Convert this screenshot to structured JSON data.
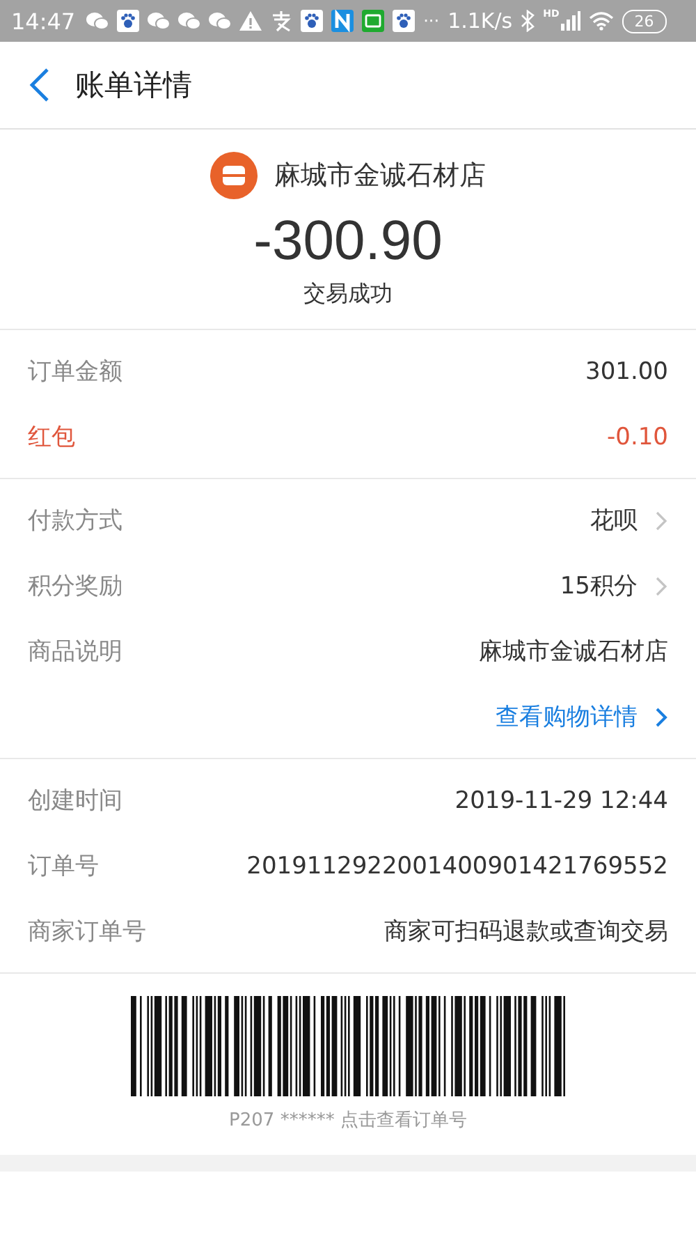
{
  "status_bar": {
    "time": "14:47",
    "icons": [
      {
        "kind": "chat"
      },
      {
        "kind": "paw"
      },
      {
        "kind": "chat"
      },
      {
        "kind": "chat"
      },
      {
        "kind": "chat"
      },
      {
        "kind": "warning"
      },
      {
        "kind": "pay"
      },
      {
        "kind": "paw"
      },
      {
        "kind": "n"
      },
      {
        "kind": "tv"
      },
      {
        "kind": "paw"
      }
    ],
    "more": "···",
    "speed": "1.1K/s",
    "network": "HD",
    "battery": "26"
  },
  "header": {
    "title": "账单详情"
  },
  "merchant": {
    "name": "麻城市金诚石材店",
    "amount": "-300.90",
    "status": "交易成功"
  },
  "sections": [
    {
      "rows": [
        {
          "label": "订单金额",
          "value": "301.00",
          "kind": "plain",
          "chevron": false
        },
        {
          "label": "红包",
          "value": "-0.10",
          "kind": "discount",
          "chevron": false
        }
      ]
    },
    {
      "rows": [
        {
          "label": "付款方式",
          "value": "花呗",
          "kind": "plain",
          "chevron": true
        },
        {
          "label": "积分奖励",
          "value": "15积分",
          "kind": "plain",
          "chevron": true
        },
        {
          "label": "商品说明",
          "value": "麻城市金诚石材店",
          "kind": "plain",
          "chevron": false
        },
        {
          "value": "查看购物详情",
          "kind": "link",
          "chevron": true
        }
      ]
    },
    {
      "rows": [
        {
          "label": "创建时间",
          "value": "2019-11-29 12:44",
          "kind": "plain",
          "chevron": false
        },
        {
          "label": "订单号",
          "value": "2019112922001400901421769552",
          "kind": "plain",
          "chevron": false
        },
        {
          "label": "商家订单号",
          "value": "商家可扫码退款或查询交易",
          "kind": "plain",
          "chevron": false
        }
      ]
    }
  ],
  "barcode": {
    "caption": "P207 ****** 点击查看订单号"
  }
}
